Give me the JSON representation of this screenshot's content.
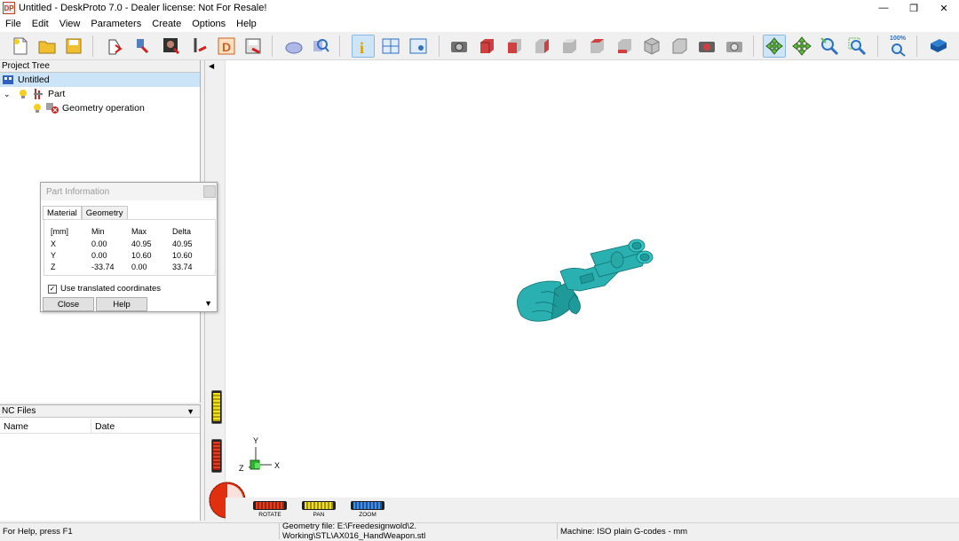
{
  "window": {
    "title": "Untitled - DeskProto 7.0 - Dealer license: Not For Resale!",
    "app_badge": "DP"
  },
  "menu": [
    "File",
    "Edit",
    "View",
    "Parameters",
    "Create",
    "Options",
    "Help"
  ],
  "toolbar": {
    "icons": [
      "new-icon",
      "open-icon",
      "save-icon",
      "part-wizard-icon",
      "import-geometry-icon",
      "bitmap-icon",
      "vector-icon",
      "operation-icon",
      "save-nc-icon",
      "mesh-icon",
      "inspect-icon",
      "info-icon",
      "layout-icon",
      "toolbar-view-icon",
      "camera-icon",
      "view-front-icon",
      "view-back-icon",
      "view-left-icon",
      "view-right-icon",
      "view-top-icon",
      "view-bottom-icon",
      "view-iso-icon",
      "view-box-icon",
      "snapshot-icon",
      "snapshot2-icon",
      "rotate-icon",
      "pan-icon",
      "zoom-icon",
      "zoom-window-icon",
      "zoom-all-icon",
      "help-book-icon"
    ],
    "zoom_label": "100%"
  },
  "project_tree": {
    "header": "Project Tree",
    "items": [
      {
        "label": "Untitled"
      },
      {
        "label": "Part"
      },
      {
        "label": "Geometry operation"
      }
    ]
  },
  "nc_files": {
    "header": "NC Files",
    "columns": [
      "Name",
      "Date"
    ]
  },
  "part_info": {
    "title": "Part Information",
    "tabs": [
      "Material",
      "Geometry"
    ],
    "headers": [
      "[mm]",
      "Min",
      "Max",
      "Delta"
    ],
    "rows": [
      {
        "axis": "X",
        "min": "0.00",
        "max": "40.95",
        "delta": "40.95"
      },
      {
        "axis": "Y",
        "min": "0.00",
        "max": "10.60",
        "delta": "10.60"
      },
      {
        "axis": "Z",
        "min": "-33.74",
        "max": "0.00",
        "delta": "33.74"
      }
    ],
    "checkbox_label": "Use translated coordinates",
    "checkbox_checked": true,
    "close_label": "Close",
    "help_label": "Help"
  },
  "viewport": {
    "axes": {
      "y": "Y",
      "x": "X",
      "z": "Z"
    },
    "controls": {
      "rotate": "ROTATE",
      "pan": "PAN",
      "zoom": "ZOOM"
    },
    "model_color": "#2ab0b0"
  },
  "status": {
    "help": "For Help, press F1",
    "geometry_file": "Geometry file: E:\\Freedesignwold\\2. Working\\STL\\AX016_HandWeapon.stl",
    "machine": "Machine: ISO plain G-codes - mm"
  }
}
